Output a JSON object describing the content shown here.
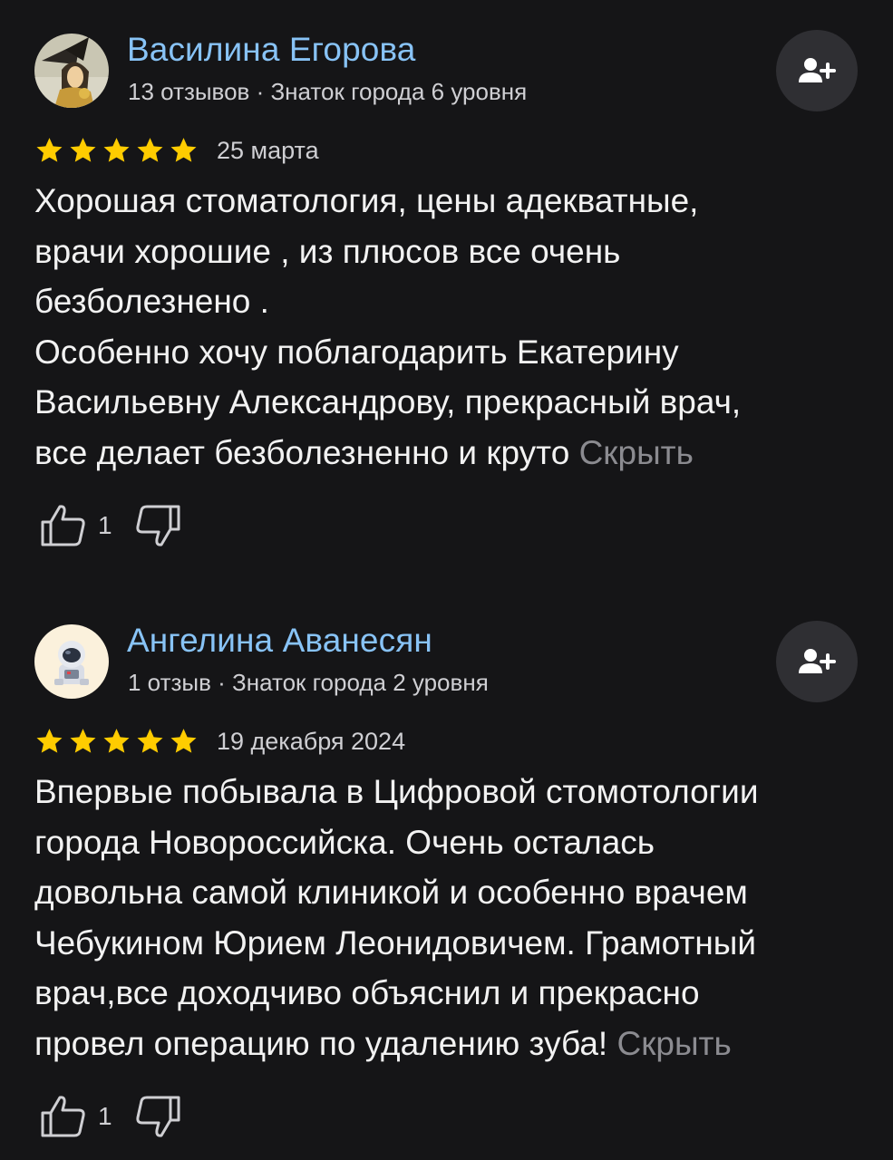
{
  "reviews": [
    {
      "author": "Василина Егорова",
      "meta": "13 отзывов · Знаток города 6 уровня",
      "avatar_icon": "woman-with-witch-hat-avatar",
      "subscribe_icon": "add-user-icon",
      "rating": 5,
      "star_color": "#ffcc00",
      "date": "25 марта",
      "text_lines": [
        "Хорошая стоматология, цены адекватные,",
        "врачи хорошие , из плюсов все очень",
        "безболезнено .",
        "Особенно хочу поблагодарить Екатерину",
        "Васильевну Александрову, прекрасный врач,",
        "все делает безболезненно и круто"
      ],
      "hide_label": "Скрыть",
      "likes": "1"
    },
    {
      "author": "Ангелина Аванесян",
      "meta": "1 отзыв · Знаток города 2 уровня",
      "avatar_icon": "astronaut-avatar",
      "subscribe_icon": "add-user-icon",
      "rating": 5,
      "star_color": "#ffcc00",
      "date": "19 декабря 2024",
      "text_lines": [
        "Впервые побывала в Цифровой стомотологии",
        "города Новороссийска. Очень осталась",
        "довольна самой клиникой и особенно врачем",
        "Чебукином Юрием Леонидовичем. Грамотный",
        "врач,все доходчиво объяснил и прекрасно",
        "провел операцию по удалению зуба!"
      ],
      "hide_label": "Скрыть",
      "likes": "1"
    }
  ],
  "colors": {
    "background": "#151517",
    "author_name": "#88c3f6",
    "secondary_text": "#cfcfd3",
    "hide_link": "#8b8b90",
    "button_bg": "#2f2f33"
  }
}
